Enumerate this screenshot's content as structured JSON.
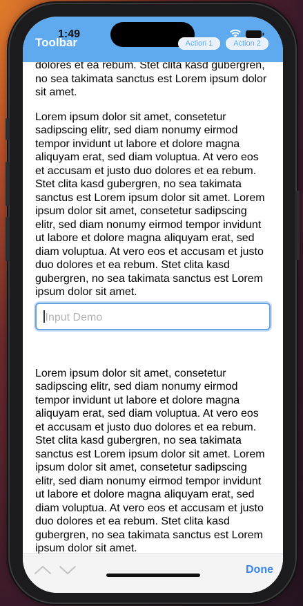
{
  "status_bar": {
    "time": "1:49"
  },
  "toolbar": {
    "title": "Toolbar",
    "action1_label": "Action 1",
    "action2_label": "Action 2"
  },
  "content": {
    "top_partial": "dolores et ea rebum. Stet clita kasd gubergren, no sea takimata sanctus est Lorem ipsum dolor sit amet.",
    "paragraph": "Lorem ipsum dolor sit amet, consetetur sadipscing elitr, sed diam nonumy eirmod tempor invidunt ut labore et dolore magna aliquyam erat, sed diam voluptua. At vero eos et accusam et justo duo dolores et ea rebum. Stet clita kasd gubergren, no sea takimata sanctus est Lorem ipsum dolor sit amet. Lorem ipsum dolor sit amet, consetetur sadipscing elitr, sed diam nonumy eirmod tempor invidunt ut labore et dolore magna aliquyam erat, sed diam voluptua. At vero eos et accusam et justo duo dolores et ea rebum. Stet clita kasd gubergren, no sea takimata sanctus est Lorem ipsum dolor sit amet.",
    "paragraph2": "Lorem ipsum dolor sit amet, consetetur sadipscing elitr, sed diam nonumy eirmod tempor invidunt ut labore et dolore magna aliquyam erat, sed diam voluptua. At vero eos et accusam et justo duo dolores et ea rebum. Stet clita kasd gubergren, no sea takimata sanctus est Lorem ipsum dolor sit amet. Lorem ipsum dolor sit amet, consetetur sadipscing elitr, sed diam nonumy eirmod tempor invidunt ut labore et dolore magna aliquyam erat, sed diam voluptua. At vero eos et accusam et justo duo dolores et ea rebum. Stet clita kasd gubergren, no sea takimata sanctus est Lorem ipsum dolor sit amet."
  },
  "input": {
    "placeholder": "Input Demo"
  },
  "keyboard_accessory": {
    "done_label": "Done"
  },
  "colors": {
    "toolbar_bg": "#5fa9ee",
    "accent": "#3a86ea"
  },
  "icons": [
    "wifi-icon",
    "battery-icon",
    "chevron-up-icon",
    "chevron-down-icon"
  ]
}
